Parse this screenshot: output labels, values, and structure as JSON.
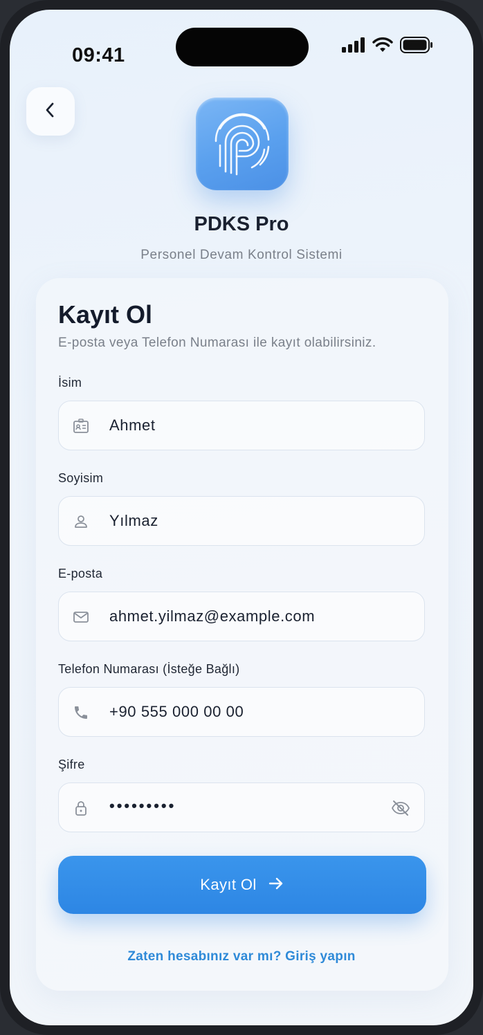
{
  "status_bar": {
    "time": "09:41"
  },
  "header": {
    "app_name": "PDKS Pro",
    "app_subtitle": "Personel Devam Kontrol Sistemi"
  },
  "form": {
    "title": "Kayıt Ol",
    "description": "E-posta veya Telefon Numarası ile kayıt olabilirsiniz.",
    "fields": [
      {
        "label": "İsim",
        "value": "Ahmet",
        "icon": "id-card-icon"
      },
      {
        "label": "Soyisim",
        "value": "Yılmaz",
        "icon": "user-icon"
      },
      {
        "label": "E-posta",
        "value": "ahmet.yilmaz@example.com",
        "icon": "mail-icon"
      },
      {
        "label": "Telefon Numarası (İsteğe Bağlı)",
        "value": "+90 555 000 00 00",
        "icon": "phone-icon"
      },
      {
        "label": "Şifre",
        "value": "•••••••••",
        "icon": "lock-icon"
      }
    ],
    "submit_label": "Kayıt Ol",
    "login_link": "Zaten hesabınız var mı? Giriş yapın"
  },
  "colors": {
    "primary": "#2d86e4",
    "link": "#2f8ad8",
    "logo_gradient": "#5aa0ee"
  }
}
